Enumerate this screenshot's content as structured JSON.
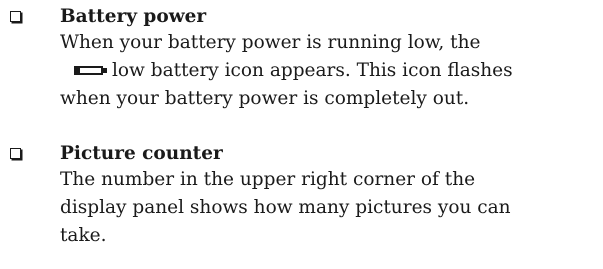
{
  "items": [
    {
      "checkbox_icon": "checkbox-icon",
      "heading": "Battery power",
      "line1": "When your battery power is running low, the",
      "line2_icon": "low-battery-icon",
      "line2_text": "low battery icon appears. This icon flashes",
      "line3": "when your battery power is completely out."
    },
    {
      "checkbox_icon": "checkbox-icon",
      "heading": "Picture counter",
      "line1": "The number in the upper right corner of the",
      "line2": "display panel shows how many pictures you can",
      "line3": "take."
    }
  ]
}
